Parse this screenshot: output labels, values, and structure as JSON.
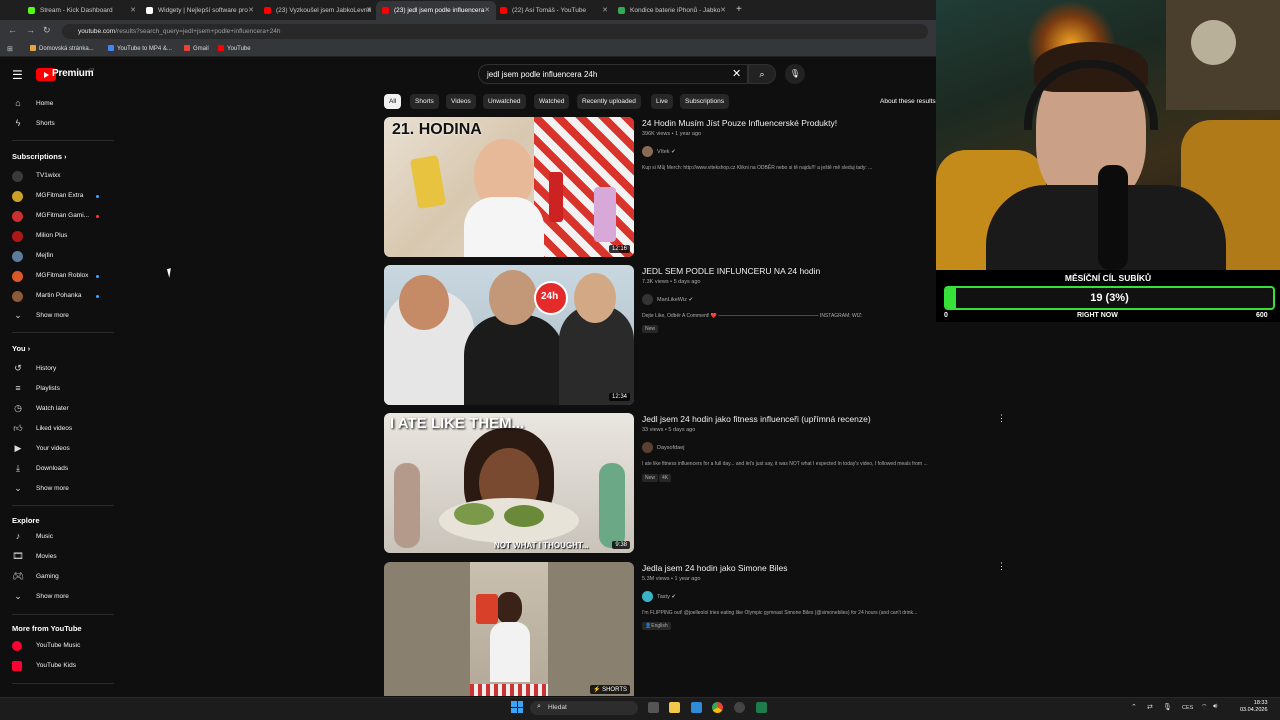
{
  "browser": {
    "tabs": [
      {
        "label": "Stream - Kick Dashboard",
        "color": "#53fc18"
      },
      {
        "label": "Widgety | Nejlepší software pro",
        "color": "#ffffff"
      },
      {
        "label": "(23) Vyzkoušel jsem JabkoLevně",
        "color": "#ff0000"
      },
      {
        "label": "(23) jedl jsem podle influencera",
        "color": "#ff0000"
      },
      {
        "label": "(22) Asi Tomáš - YouTube",
        "color": "#ff0000"
      },
      {
        "label": "Kondice baterie iPhonů - Jabko",
        "color": "#34a853"
      }
    ],
    "url_host": "youtube.com",
    "url_path": "/results?search_query=jedl+jsem+podle+influencera+24h",
    "bookmarks": [
      {
        "label": "Domovská stránka...",
        "color": "#e8a33b"
      },
      {
        "label": "YouTube to MP4 &...",
        "color": "#4285f4"
      },
      {
        "label": "Gmail",
        "color": "#ea4335"
      },
      {
        "label": "YouTube",
        "color": "#ff0000"
      }
    ]
  },
  "youtube": {
    "logo_text": "Premium",
    "logo_country": "CZ",
    "search_value": "jedl jsem podle influencera 24h",
    "chips": [
      "All",
      "Shorts",
      "Videos",
      "Unwatched",
      "Watched",
      "Recently uploaded",
      "Live",
      "Subscriptions"
    ],
    "about_results": "About these results"
  },
  "sidebar": {
    "home": "Home",
    "shorts": "Shorts",
    "subscriptions_title": "Subscriptions",
    "subscriptions": [
      {
        "label": "TV1wixx",
        "color": "#3a3a3a"
      },
      {
        "label": "MGFitman Extra",
        "color": "#c9a227"
      },
      {
        "label": "MGFitman Gami...",
        "color": "#c93030"
      },
      {
        "label": "Milion Plus",
        "color": "#b01818"
      },
      {
        "label": "Mejfin",
        "color": "#5c7c9c"
      },
      {
        "label": "MGFitman Roblox",
        "color": "#d85a2a"
      },
      {
        "label": "Martin Pohanka",
        "color": "#8a5a3a"
      }
    ],
    "show_more": "Show more",
    "you_title": "You",
    "you_items": [
      "History",
      "Playlists",
      "Watch later",
      "Liked videos",
      "Your videos",
      "Downloads"
    ],
    "explore_title": "Explore",
    "explore_items": [
      "Music",
      "Movies",
      "Gaming"
    ],
    "more_title": "More from YouTube",
    "more_items": [
      "YouTube Music",
      "YouTube Kids"
    ]
  },
  "videos": [
    {
      "title": "24 Hodin Musím Jíst Pouze Influencerské Produkty!",
      "meta": "396K views • 1 year ago",
      "channel": "Vítek",
      "desc": "Kup si Můj Merch: http://www.vitekshop.cz Klikni na ODBĚR nebo si tě najdu!!! a ještě mě sleduj tady: ...",
      "duration": "12:16",
      "thumb_text": "21. HODINA",
      "badges": []
    },
    {
      "title": "JEDL SEM PODLE INFLUNCERU NA 24 hodin",
      "meta": "7.3K views • 5 days ago",
      "channel": "ManLikeWiz",
      "desc": "Dejte Like, Odběr A Comment! ❤️ ———————————————————— INSTAGRAM: WIZ:",
      "duration": "12:34",
      "thumb_text": "24h",
      "badges": [
        "New"
      ]
    },
    {
      "title": "Jedl jsem 24 hodin jako fitness influenceři (upřímná recenze)",
      "meta": "33 views • 5 days ago",
      "channel": "Daysofdaej",
      "desc": "I ate like fitness influencers for a full day... and let's just say, it was NOT what I expected In today's video, I followed meals from ...",
      "duration": "9:38",
      "thumb_text": "I ATE LIKE THEM...",
      "thumb_text2": "NOT WHAT I THOUGHT...",
      "badges": [
        "New",
        "4K"
      ]
    },
    {
      "title": "Jedla jsem 24 hodin jako Simone Biles",
      "meta": "5.3M views • 1 year ago",
      "channel": "Tasty",
      "desc": "I'm FLIPPING out! @joelleolol tries eating like Olympic gymnast Simone Biles (@simonebiles) for 24 hours (and can't drink...",
      "duration": "SHORTS",
      "badges": [
        "English"
      ]
    }
  ],
  "stream_overlay": {
    "title": "MĚSÍČNÍ CÍL SUBÍKŮ",
    "value": "19 (3%)",
    "progress_fraction": 0.03,
    "min": "0",
    "label": "RIGHT NOW",
    "max": "600",
    "accent": "#36e23a"
  },
  "taskbar": {
    "search_placeholder": "Hledat",
    "lang": "CES",
    "time": "18:33",
    "date": "03.04.2026"
  }
}
